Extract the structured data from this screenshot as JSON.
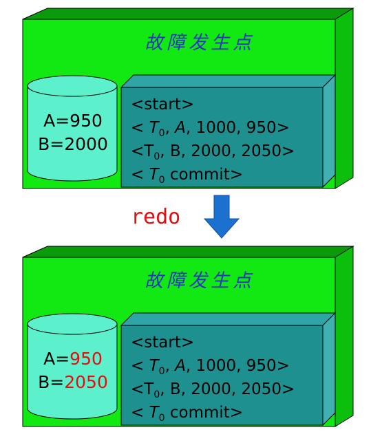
{
  "diagram": {
    "top": {
      "title": "故障发生点",
      "cylinder": {
        "a_label": "A=",
        "a_value": "950",
        "b_label": "B=",
        "b_value": "2000"
      },
      "log": {
        "line1": "<start>",
        "line2": {
          "prefix": "< ",
          "var": "T",
          "sub": "0",
          "rest1": ", ",
          "rest2": "A",
          "rest3": ", 1000, 950>"
        },
        "line3": {
          "prefix": "<T",
          "sub": "0",
          "rest": ", B, 2000, 2050>"
        },
        "line4": {
          "prefix": "< ",
          "var": "T",
          "sub": "0",
          "rest": " commit>"
        }
      }
    },
    "arrow_label": "redo",
    "bottom": {
      "title": "故障发生点",
      "cylinder": {
        "a_label": "A=",
        "a_value": "950",
        "b_label": "B=",
        "b_value": "2050"
      },
      "log": {
        "line1": "<start>",
        "line2": {
          "prefix": "< ",
          "var": "T",
          "sub": "0",
          "rest1": ", ",
          "rest2": "A",
          "rest3": ", 1000, 950>"
        },
        "line3": {
          "prefix": "<T",
          "sub": "0",
          "rest": ", B, 2000, 2050>"
        },
        "line4": {
          "prefix": "< ",
          "var": "T",
          "sub": "0",
          "rest": " commit>"
        }
      }
    },
    "colors": {
      "panel_front": "#12e812",
      "panel_side": "#0cbf0c",
      "panel_top": "#0a9a0a",
      "cylinder": "#5cf0cc",
      "log_box": "#1f9090",
      "arrow": "#1c70d0",
      "title": "#2a35c0",
      "changed_value": "#e01010"
    }
  }
}
